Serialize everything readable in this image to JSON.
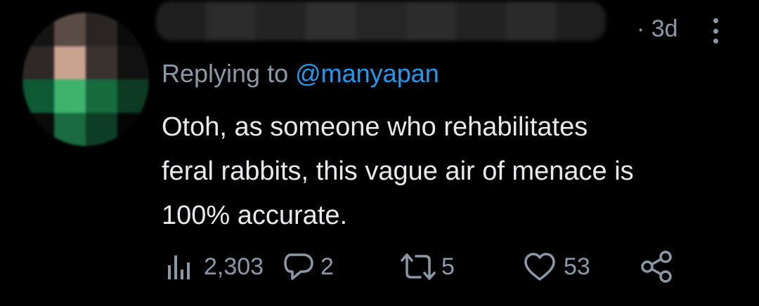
{
  "tweet": {
    "timestamp": "· 3d",
    "replying_prefix": "Replying to ",
    "replying_handle": "@manyapan",
    "text_lines": [
      "Otoh, as someone who rehabilitates",
      "feral rabbits, this vague air of menace is",
      "100% accurate."
    ]
  },
  "actions": {
    "views": "2,303",
    "replies": "2",
    "retweets": "5",
    "likes": "53"
  },
  "icons": {
    "views": "views-icon",
    "reply": "reply-icon",
    "retweet": "retweet-icon",
    "like": "heart-icon",
    "share": "share-icon",
    "more": "more-icon"
  },
  "colors": {
    "background": "#000000",
    "text": "#e7e9ea",
    "muted": "#8b98a5",
    "link": "#1d9bf0"
  }
}
